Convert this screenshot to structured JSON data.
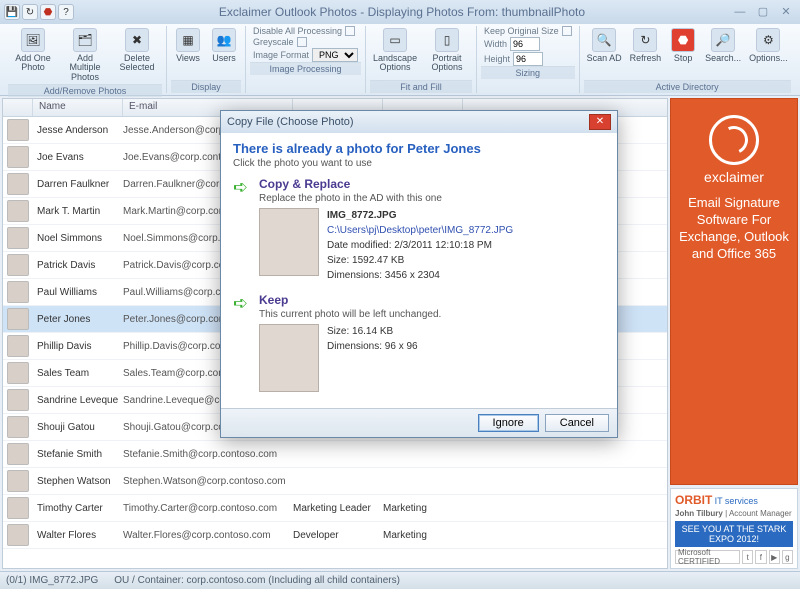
{
  "titlebar": {
    "title": "Exclaimer Outlook Photos - Displaying Photos From: thumbnailPhoto"
  },
  "ribbon": {
    "add_one": "Add One Photo",
    "add_multiple": "Add Multiple Photos",
    "delete_selected": "Delete Selected",
    "views": "Views",
    "users": "Users",
    "disable_all": "Disable All Processing",
    "greyscale": "Greyscale",
    "image_format_lbl": "Image Format",
    "image_format_val": "PNG",
    "landscape": "Landscape Options",
    "portrait": "Portrait Options",
    "keep_original": "Keep Original Size",
    "width_lbl": "Width",
    "width_val": "96",
    "height_lbl": "Height",
    "height_val": "96",
    "scan": "Scan AD",
    "refresh": "Refresh",
    "stop": "Stop",
    "search": "Search...",
    "options": "Options...",
    "g1": "Add/Remove Photos",
    "g2": "Display",
    "g3": "Image Processing",
    "g4": "Fit and Fill",
    "g5": "Sizing",
    "g6": "Active Directory"
  },
  "grid": {
    "h_name": "Name",
    "h_email": "E-mail",
    "rows": [
      {
        "name": "Jesse Anderson",
        "email": "Jesse.Anderson@corp.contoso.com",
        "c3": "",
        "c4": ""
      },
      {
        "name": "Joe Evans",
        "email": "Joe.Evans@corp.contoso.com",
        "c3": "",
        "c4": ""
      },
      {
        "name": "Darren Faulkner",
        "email": "Darren.Faulkner@corp.contoso.com",
        "c3": "",
        "c4": ""
      },
      {
        "name": "Mark T. Martin",
        "email": "Mark.Martin@corp.contoso.com",
        "c3": "",
        "c4": ""
      },
      {
        "name": "Noel Simmons",
        "email": "Noel.Simmons@corp.contoso.com",
        "c3": "",
        "c4": ""
      },
      {
        "name": "Patrick Davis",
        "email": "Patrick.Davis@corp.contoso.com",
        "c3": "",
        "c4": ""
      },
      {
        "name": "Paul Williams",
        "email": "Paul.Williams@corp.contoso.com",
        "c3": "",
        "c4": ""
      },
      {
        "name": "Peter Jones",
        "email": "Peter.Jones@corp.contoso.com",
        "c3": "",
        "c4": ""
      },
      {
        "name": "Phillip Davis",
        "email": "Phillip.Davis@corp.contoso.com",
        "c3": "",
        "c4": ""
      },
      {
        "name": "Sales Team",
        "email": "Sales.Team@corp.contoso.com",
        "c3": "",
        "c4": ""
      },
      {
        "name": "Sandrine Leveque",
        "email": "Sandrine.Leveque@corp.contoso.com",
        "c3": "",
        "c4": ""
      },
      {
        "name": "Shouji Gatou",
        "email": "Shouji.Gatou@corp.contoso.com",
        "c3": "",
        "c4": ""
      },
      {
        "name": "Stefanie Smith",
        "email": "Stefanie.Smith@corp.contoso.com",
        "c3": "",
        "c4": ""
      },
      {
        "name": "Stephen Watson",
        "email": "Stephen.Watson@corp.contoso.com",
        "c3": "",
        "c4": ""
      },
      {
        "name": "Timothy Carter",
        "email": "Timothy.Carter@corp.contoso.com",
        "c3": "Marketing Leader",
        "c4": "Marketing"
      },
      {
        "name": "Walter Flores",
        "email": "Walter.Flores@corp.contoso.com",
        "c3": "Developer",
        "c4": "Marketing"
      }
    ],
    "selected_index": 7
  },
  "sidebar": {
    "brand": "exclaimer",
    "ad_text": "Email Signature Software For Exchange, Outlook and Office 365",
    "orbit": "ORBIT",
    "orbit_sub": "IT services",
    "contact_name": "John Tilbury",
    "contact_role": "Account Manager",
    "banner": "SEE YOU AT THE STARK EXPO 2012!",
    "cert": "Microsoft CERTIFIED"
  },
  "status": {
    "left": "(0/1) IMG_8772.JPG",
    "right": "OU / Container: corp.contoso.com (Including all child containers)"
  },
  "dialog": {
    "title": "Copy File (Choose Photo)",
    "heading": "There is already a photo for Peter Jones",
    "sub": "Click the photo you want to use",
    "opt1_title": "Copy & Replace",
    "opt1_desc": "Replace the photo in the AD with this one",
    "opt1_filename": "IMG_8772.JPG",
    "opt1_path": "C:\\Users\\pj\\Desktop\\peter\\IMG_8772.JPG",
    "opt1_date": "Date modified: 2/3/2011 12:10:18 PM",
    "opt1_size": "Size: 1592.47 KB",
    "opt1_dim": "Dimensions: 3456 x 2304",
    "opt2_title": "Keep",
    "opt2_desc": "This current photo will be left unchanged.",
    "opt2_size": "Size: 16.14 KB",
    "opt2_dim": "Dimensions: 96 x 96",
    "btn_ignore": "Ignore",
    "btn_cancel": "Cancel"
  }
}
